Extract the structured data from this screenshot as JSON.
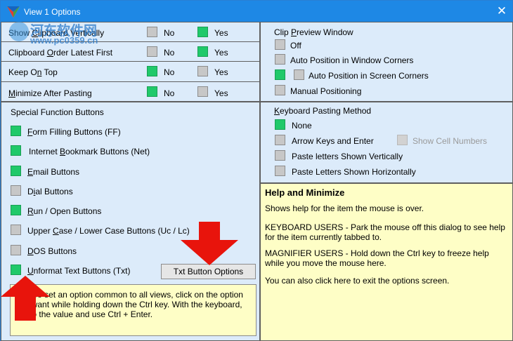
{
  "window": {
    "title": "View 1 Options",
    "close_icon": "close-icon"
  },
  "options": {
    "labels": {
      "no": "No",
      "yes": "Yes"
    },
    "rows": [
      {
        "label_pre": "Show ",
        "label_u": "C",
        "label_post": "lipboard Vertically",
        "no": false,
        "yes": true
      },
      {
        "label_pre": "Clipboard ",
        "label_u": "O",
        "label_post": "rder Latest First",
        "no": false,
        "yes": true
      },
      {
        "label_pre": "Keep O",
        "label_u": "n",
        "label_post": " Top",
        "no": true,
        "yes": false
      },
      {
        "label_pre": "",
        "label_u": "M",
        "label_post": "inimize After Pasting",
        "no": true,
        "yes": false
      }
    ]
  },
  "clip_preview": {
    "heading_pre": "Clip ",
    "heading_u": "P",
    "heading_post": "review Window",
    "items": [
      {
        "label": "Off",
        "checked": false
      },
      {
        "label": "Auto Position in Window Corners",
        "checked": false
      },
      {
        "label": "Auto Position in Screen Corners",
        "checked": true
      },
      {
        "label": "Manual Positioning",
        "checked": false
      }
    ]
  },
  "special": {
    "heading": "Special Function Buttons",
    "items": [
      {
        "pre": "",
        "u": "F",
        "post": "orm Filling Buttons (FF)",
        "checked": true
      },
      {
        "pre": "Internet ",
        "u": "B",
        "post": "ookmark Buttons (Net)",
        "checked": true
      },
      {
        "pre": "",
        "u": "E",
        "post": "mail Buttons",
        "checked": true
      },
      {
        "pre": "D",
        "u": "i",
        "post": "al Buttons",
        "checked": false
      },
      {
        "pre": "",
        "u": "R",
        "post": "un / Open Buttons",
        "checked": true
      },
      {
        "pre": "Upper ",
        "u": "C",
        "post": "ase / Lower Case Buttons (Uc / Lc)",
        "checked": false
      },
      {
        "pre": "",
        "u": "D",
        "post": "OS Buttons",
        "checked": false
      },
      {
        "pre": "",
        "u": "U",
        "post": "nformat Text Buttons (Txt)",
        "checked": true
      }
    ],
    "txt_button": "Txt Button Options",
    "note": "TIP:  To set an option common to all views, click on the option you want while holding down the Ctrl key. With the keyboard, tab to the value and use Ctrl + Enter."
  },
  "keyboard": {
    "heading_pre": "",
    "heading_u": "K",
    "heading_post": "eyboard Pasting Method",
    "items": [
      {
        "label": "None",
        "checked": true
      },
      {
        "label": "Arrow Keys and Enter",
        "checked": false
      },
      {
        "label": "Paste letters Shown Vertically",
        "checked": false
      },
      {
        "label": "Paste Letters Shown Horizontally",
        "checked": false
      }
    ],
    "show_cell_numbers": "Show Cell Numbers"
  },
  "help": {
    "title": "Help and Minimize",
    "p1": "Shows help for the item the mouse is over.",
    "p2": "KEYBOARD USERS - Park the mouse off this dialog to see help for the item currently tabbed to.",
    "p3": "MAGNIFIER USERS - Hold down the Ctrl key to freeze help while you move the mouse here.",
    "p4": "You can also click here to exit the options screen."
  },
  "watermark": {
    "line1": "河东软件网",
    "line2": "www.pc0359.cn"
  },
  "colors": {
    "titlebar": "#1e88e5",
    "panel": "#dcebfa",
    "checked": "#20c96a",
    "help_bg": "#fefec6",
    "arrow": "#e8140c"
  }
}
